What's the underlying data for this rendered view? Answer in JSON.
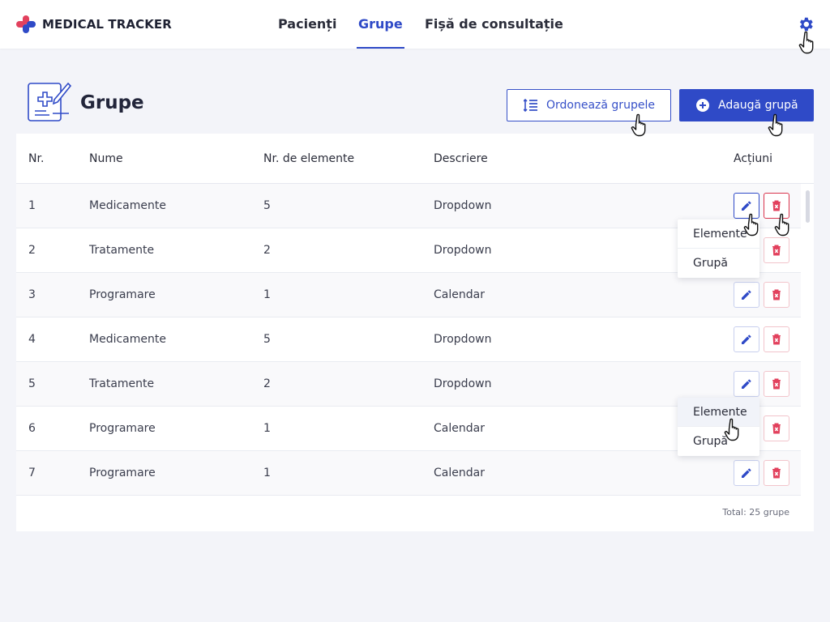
{
  "app": {
    "name": "MEDICAL TRACKER"
  },
  "nav": {
    "tabs": [
      {
        "label": "Pacienți",
        "active": false
      },
      {
        "label": "Grupe",
        "active": true
      },
      {
        "label": "Fișă de consultație",
        "active": false
      }
    ]
  },
  "page": {
    "title": "Grupe",
    "sort_button": "Ordonează grupele",
    "add_button": "Adaugă grupă"
  },
  "table": {
    "headers": {
      "nr": "Nr.",
      "name": "Nume",
      "count": "Nr. de elemente",
      "description": "Descriere",
      "actions": "Acțiuni"
    },
    "rows": [
      {
        "nr": "1",
        "name": "Medicamente",
        "count": "5",
        "description": "Dropdown"
      },
      {
        "nr": "2",
        "name": "Tratamente",
        "count": "2",
        "description": "Dropdown"
      },
      {
        "nr": "3",
        "name": "Programare",
        "count": "1",
        "description": "Calendar"
      },
      {
        "nr": "4",
        "name": "Medicamente",
        "count": "5",
        "description": "Dropdown"
      },
      {
        "nr": "5",
        "name": "Tratamente",
        "count": "2",
        "description": "Dropdown"
      },
      {
        "nr": "6",
        "name": "Programare",
        "count": "1",
        "description": "Calendar"
      },
      {
        "nr": "7",
        "name": "Programare",
        "count": "1",
        "description": "Calendar"
      }
    ],
    "total": "Total: 25 grupe"
  },
  "menus": [
    {
      "items": [
        "Elemente",
        "Grupă"
      ]
    },
    {
      "items": [
        "Elemente",
        "Grupă"
      ]
    }
  ],
  "colors": {
    "accent": "#2f4ac7",
    "danger": "#d9344d",
    "background": "#f3f4f9"
  }
}
